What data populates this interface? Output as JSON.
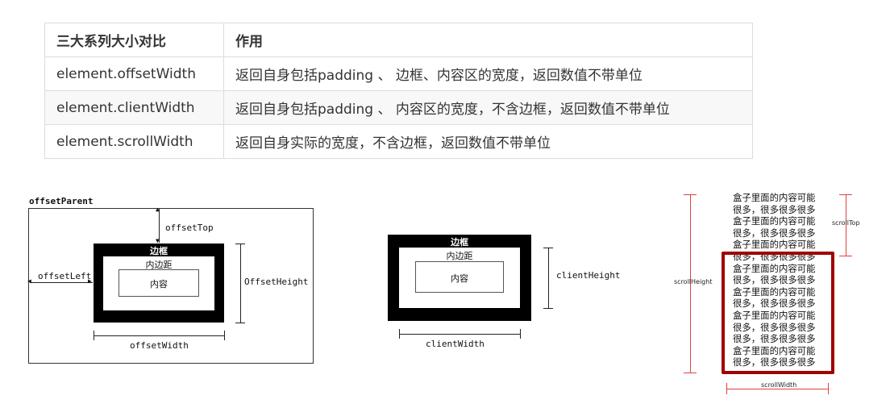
{
  "table": {
    "headers": [
      "三大系列大小对比",
      "作用"
    ],
    "rows": [
      [
        "element.offsetWidth",
        "返回自身包括padding 、 边框、内容区的宽度，返回数值不带单位"
      ],
      [
        "element.clientWidth",
        "返回自身包括padding 、 内容区的宽度，不含边框，返回数值不带单位"
      ],
      [
        "element.scrollWidth",
        "返回自身实际的宽度，不含边框，返回数值不带单位"
      ]
    ]
  },
  "offset_diagram": {
    "parent_label": "offsetParent",
    "border_label": "边框",
    "padding_label": "内边距",
    "content_label": "内容",
    "top_label": "offsetTop",
    "left_label": "offsetLeft",
    "height_label": "OffsetHeight",
    "width_label": "offsetWidth"
  },
  "client_diagram": {
    "border_label": "边框",
    "padding_label": "内边距",
    "content_label": "内容",
    "height_label": "clientHeight",
    "width_label": "clientWidth"
  },
  "scroll_diagram": {
    "content_lines": [
      "盒子里面的内容可能",
      "很多，很多很多很多",
      "盒子里面的内容可能",
      "很多，很多很多很多",
      "盒子里面的内容可能",
      "很多，很多很多很多",
      "盒子里面的内容可能",
      "很多，很多很多很多",
      "盒子里面的内容可能",
      "很多，很多很多很多",
      "盒子里面的内容可能",
      "很多，很多很多很多",
      "很多，很多很多很多",
      "盒子里面的内容可能",
      "很多，很多很多很多"
    ],
    "height_label": "scrollHeight",
    "top_label": "scrollTop",
    "width_label": "scrollWidth",
    "border_color": "#a00000"
  }
}
